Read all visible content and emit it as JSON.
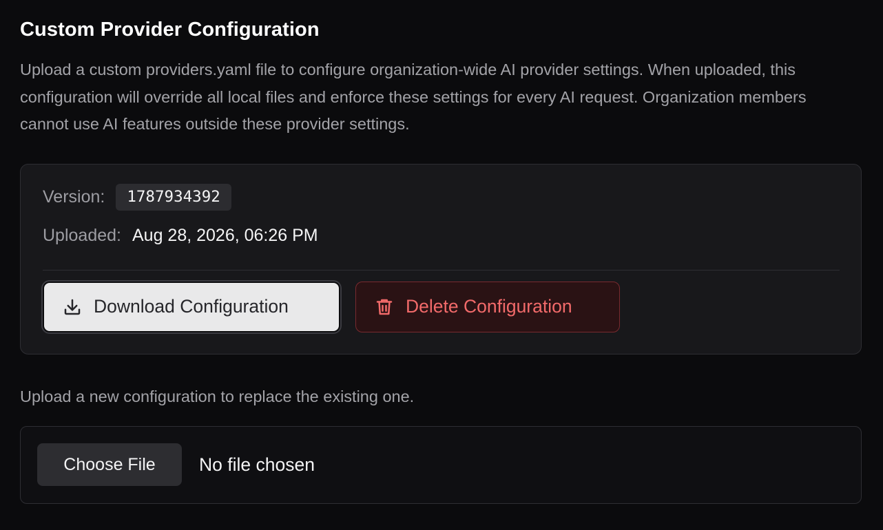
{
  "section": {
    "title": "Custom Provider Configuration",
    "description": "Upload a custom providers.yaml file to configure organization-wide AI provider settings. When uploaded, this configuration will override all local files and enforce these settings for every AI request. Organization members cannot use AI features outside these provider settings."
  },
  "config": {
    "version_label": "Version:",
    "version_value": "1787934392",
    "uploaded_label": "Uploaded:",
    "uploaded_value": "Aug 28, 2026, 06:26 PM"
  },
  "actions": {
    "download_label": "Download Configuration",
    "download_icon": "download-icon",
    "delete_label": "Delete Configuration",
    "delete_icon": "trash-icon"
  },
  "upload": {
    "hint": "Upload a new configuration to replace the existing one.",
    "choose_label": "Choose File",
    "status": "No file chosen"
  },
  "colors": {
    "background": "#0b0b0d",
    "card": "#18181b",
    "danger": "#f26a6a",
    "download_bg": "#e9e9ea"
  }
}
